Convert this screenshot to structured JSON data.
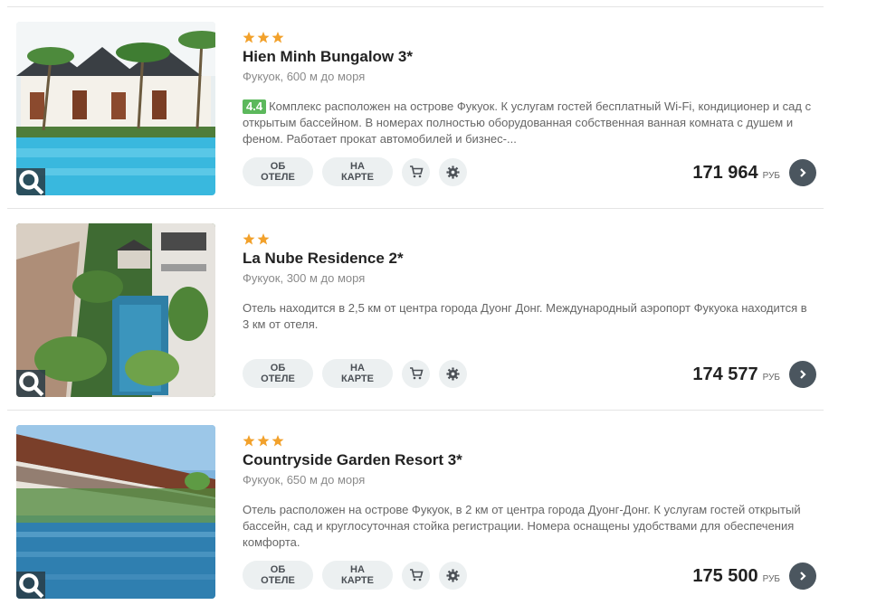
{
  "colors": {
    "star": "#f2a12b",
    "rating_bg": "#5cb85c",
    "pill_bg": "#ecf0f1",
    "go_bg": "#4b565f"
  },
  "labels": {
    "about": "ОБ ОТЕЛЕ",
    "map": "НА КАРТЕ",
    "currency": "РУБ"
  },
  "icons": {
    "zoom": "search-icon",
    "cart": "cart-icon",
    "settings": "gear-icon",
    "go": "chevron-right-icon",
    "star": "star-icon"
  },
  "hotels": [
    {
      "stars": 3,
      "name": "Hien Minh Bungalow 3*",
      "location": "Фукуок, 600 м до моря",
      "rating": "4.4",
      "description": "Комплекс расположен на острове Фукуок. К услугам гостей бесплатный Wi-Fi, кондиционер и сад с открытым бассейном. В номерах полностью оборудованная собственная ванная комната с душем и феном. Работает прокат автомобилей и бизнес-...",
      "price": "171 964"
    },
    {
      "stars": 2,
      "name": "La Nube Residence 2*",
      "location": "Фукуок, 300 м до моря",
      "rating": "",
      "description": "Отель находится в 2,5 км от центра города Дуонг Донг. Международный аэропорт Фукуока находится в 3 км от отеля.",
      "price": "174 577"
    },
    {
      "stars": 3,
      "name": "Countryside Garden Resort 3*",
      "location": "Фукуок, 650 м до моря",
      "rating": "",
      "description": "Отель расположен на острове Фукуок, в 2 км от центра города Дуонг-Донг. К услугам гостей открытый бассейн, сад и круглосуточная стойка регистрации. Номера оснащены удобствами для обеспечения комфорта.",
      "price": "175 500"
    }
  ]
}
